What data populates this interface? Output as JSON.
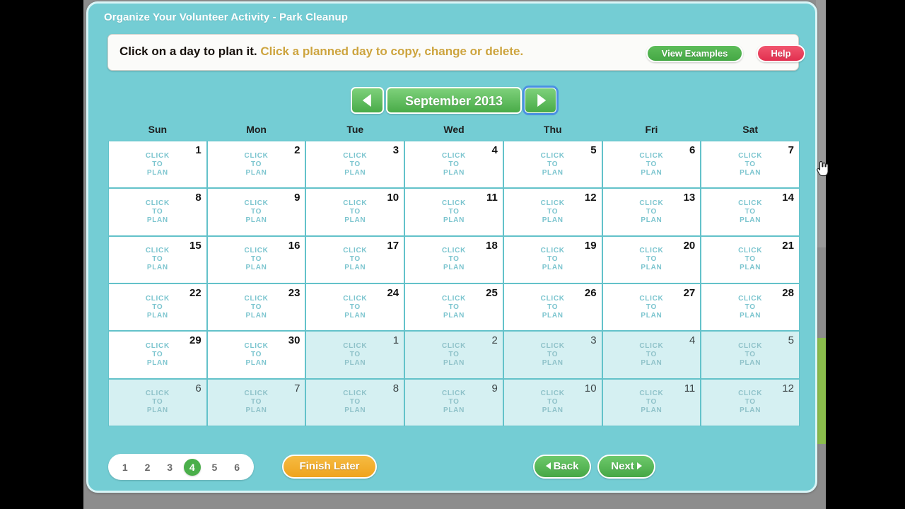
{
  "window": {
    "title": "Organize Your Volunteer Activity - Park Cleanup"
  },
  "instruction": {
    "primary": "Click on a day to plan it.",
    "secondary": "Click a planned day to copy, change or delete.",
    "view_examples_label": "View Examples",
    "help_label": "Help"
  },
  "month_nav": {
    "prev_icon": "triangle-left-icon",
    "next_icon": "triangle-right-icon",
    "label": "September 2013",
    "next_focused": true
  },
  "calendar": {
    "weekdays": [
      "Sun",
      "Mon",
      "Tue",
      "Wed",
      "Thu",
      "Fri",
      "Sat"
    ],
    "cell_label": "CLICK\nTO\nPLAN",
    "cell_label_lines": [
      "CLICK",
      "TO",
      "PLAN"
    ],
    "weeks": [
      [
        {
          "day": "1",
          "outside": false
        },
        {
          "day": "2",
          "outside": false
        },
        {
          "day": "3",
          "outside": false
        },
        {
          "day": "4",
          "outside": false
        },
        {
          "day": "5",
          "outside": false
        },
        {
          "day": "6",
          "outside": false
        },
        {
          "day": "7",
          "outside": false
        }
      ],
      [
        {
          "day": "8",
          "outside": false
        },
        {
          "day": "9",
          "outside": false
        },
        {
          "day": "10",
          "outside": false
        },
        {
          "day": "11",
          "outside": false
        },
        {
          "day": "12",
          "outside": false
        },
        {
          "day": "13",
          "outside": false
        },
        {
          "day": "14",
          "outside": false
        }
      ],
      [
        {
          "day": "15",
          "outside": false
        },
        {
          "day": "16",
          "outside": false
        },
        {
          "day": "17",
          "outside": false
        },
        {
          "day": "18",
          "outside": false
        },
        {
          "day": "19",
          "outside": false
        },
        {
          "day": "20",
          "outside": false
        },
        {
          "day": "21",
          "outside": false
        }
      ],
      [
        {
          "day": "22",
          "outside": false
        },
        {
          "day": "23",
          "outside": false
        },
        {
          "day": "24",
          "outside": false
        },
        {
          "day": "25",
          "outside": false
        },
        {
          "day": "26",
          "outside": false
        },
        {
          "day": "27",
          "outside": false
        },
        {
          "day": "28",
          "outside": false
        }
      ],
      [
        {
          "day": "29",
          "outside": false
        },
        {
          "day": "30",
          "outside": false
        },
        {
          "day": "1",
          "outside": true
        },
        {
          "day": "2",
          "outside": true
        },
        {
          "day": "3",
          "outside": true
        },
        {
          "day": "4",
          "outside": true
        },
        {
          "day": "5",
          "outside": true
        }
      ],
      [
        {
          "day": "6",
          "outside": true
        },
        {
          "day": "7",
          "outside": true
        },
        {
          "day": "8",
          "outside": true
        },
        {
          "day": "9",
          "outside": true
        },
        {
          "day": "10",
          "outside": true
        },
        {
          "day": "11",
          "outside": true
        },
        {
          "day": "12",
          "outside": true
        }
      ]
    ],
    "cursor": {
      "icon": "pointing-hand-cursor",
      "on_day": "7"
    }
  },
  "footer": {
    "pages": [
      "1",
      "2",
      "3",
      "4",
      "5",
      "6"
    ],
    "active_page": "4",
    "finish_later_label": "Finish Later",
    "back_label": "Back",
    "next_label": "Next"
  },
  "colors": {
    "panel_bg": "#74cdd4",
    "panel_border": "#d9f5f7",
    "grid_line": "#63c2ca",
    "outside_day_bg": "#d5f0f2",
    "click_to_plan_text": "#7cc5cf",
    "green_button": "#4aaf4a",
    "help_red": "#e2304f",
    "orange_button": "#efa31d",
    "instruction_gold": "#cda43e",
    "page_bg": "#8d8d8d"
  }
}
